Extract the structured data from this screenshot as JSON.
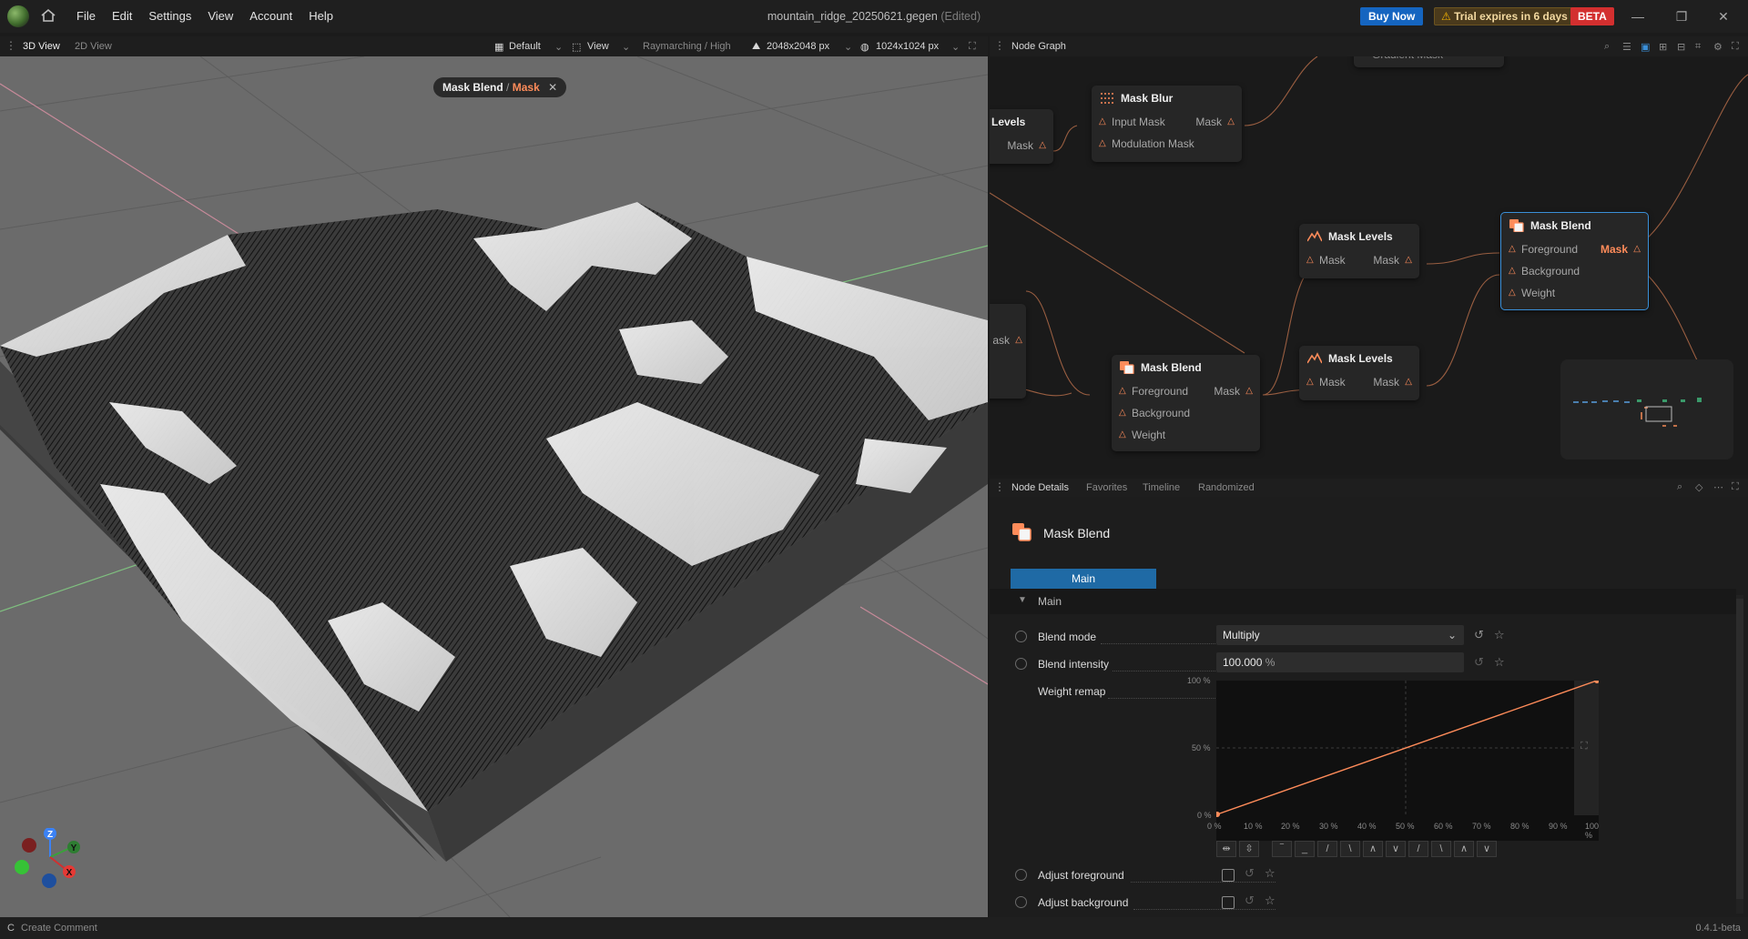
{
  "menu": [
    "File",
    "Edit",
    "Settings",
    "View",
    "Account",
    "Help"
  ],
  "document": {
    "filename": "mountain_ridge_20250621.gegen",
    "state": "(Edited)"
  },
  "header": {
    "buy_label": "Buy Now",
    "trial_label": "Trial expires in 6 days",
    "beta_label": "BETA"
  },
  "view3d": {
    "tabs": [
      "3D View",
      "2D View"
    ],
    "preset": "Default",
    "view_label": "View",
    "render_mode": "Raymarching / High",
    "terrain_resolution": "2048x2048 px",
    "output_resolution": "1024x1024 px",
    "breadcrumb_node": "Mask Blend",
    "breadcrumb_sep": "/",
    "breadcrumb_output": "Mask",
    "axes": {
      "z": "Z",
      "y": "Y",
      "x": "X"
    }
  },
  "graph": {
    "title": "Node Graph",
    "nodes": {
      "levels_left": {
        "title": "Levels",
        "out": "Mask"
      },
      "mask_blur": {
        "title": "Mask Blur",
        "in1": "Input Mask",
        "in2": "Modulation Mask",
        "out": "Mask"
      },
      "mask_levels_a": {
        "title": "Mask Levels",
        "in": "Mask",
        "out": "Mask"
      },
      "mask_levels_b": {
        "title": "Mask Levels",
        "in": "Mask",
        "out": "Mask"
      },
      "mask_blend_sel": {
        "title": "Mask Blend",
        "in1": "Foreground",
        "in2": "Background",
        "in3": "Weight",
        "out": "Mask"
      },
      "mask_blend_b": {
        "title": "Mask Blend",
        "in1": "Foreground",
        "in2": "Background",
        "in3": "Weight",
        "out": "Mask"
      },
      "partial_left": {
        "out": "ask"
      },
      "gradient_top": {
        "title": "Gradient Mask"
      }
    }
  },
  "details": {
    "tabs": [
      "Node Details",
      "Favorites",
      "Timeline",
      "Randomized"
    ],
    "node_title": "Mask Blend",
    "main_tab": "Main",
    "section_label": "Main",
    "blend_mode_label": "Blend mode",
    "blend_mode_value": "Multiply",
    "blend_intensity_label": "Blend intensity",
    "blend_intensity_value": "100.000",
    "blend_intensity_unit": "%",
    "weight_remap_label": "Weight remap",
    "y_ticks": [
      "100 %",
      "50 %",
      "0 %"
    ],
    "x_ticks": [
      "0 %",
      "10 %",
      "20 %",
      "30 %",
      "40 %",
      "50 %",
      "60 %",
      "70 %",
      "80 %",
      "90 %",
      "100 %"
    ],
    "adjust_fg_label": "Adjust foreground",
    "adjust_bg_label": "Adjust background",
    "adjust_fg_checked": false,
    "adjust_bg_checked": false
  },
  "status": {
    "comment_key": "C",
    "comment_label": "Create Comment",
    "version": "0.4.1-beta"
  },
  "colors": {
    "accent": "#ff8c5a",
    "selection": "#3a8fd8",
    "primary": "#1f6aa5",
    "beta": "#d32f2f"
  }
}
